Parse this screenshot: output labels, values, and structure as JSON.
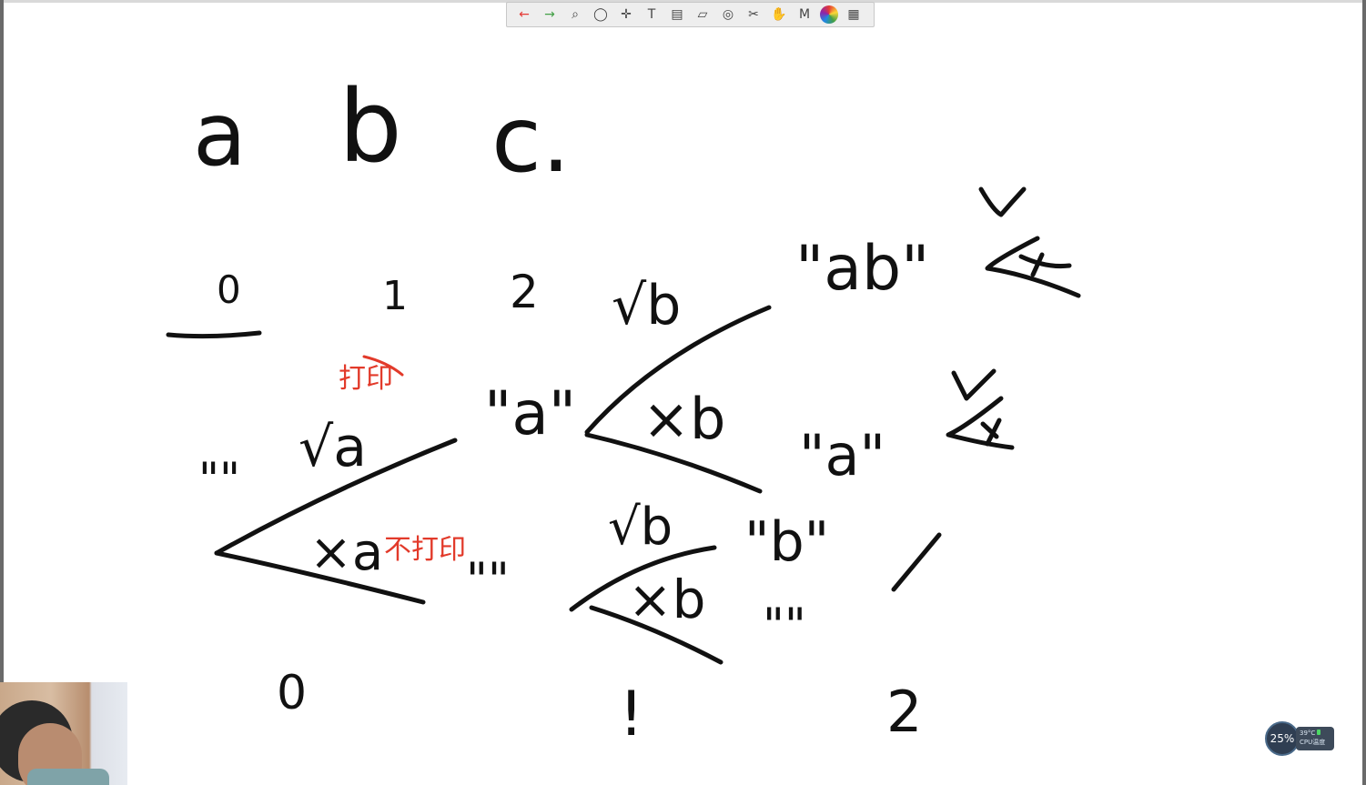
{
  "toolbar": {
    "tools": [
      {
        "name": "undo-icon",
        "glyph": "←",
        "color": "#e53935"
      },
      {
        "name": "redo-icon",
        "glyph": "→",
        "color": "#43a047"
      },
      {
        "name": "zoom-icon",
        "glyph": "⌕"
      },
      {
        "name": "lasso-icon",
        "glyph": "◯"
      },
      {
        "name": "move-icon",
        "glyph": "✛"
      },
      {
        "name": "text-tool-icon",
        "glyph": "T"
      },
      {
        "name": "clipboard-icon",
        "glyph": "▤"
      },
      {
        "name": "eraser-icon",
        "glyph": "▱"
      },
      {
        "name": "target-icon",
        "glyph": "◎"
      },
      {
        "name": "scissors-icon",
        "glyph": "✂"
      },
      {
        "name": "hand-icon",
        "glyph": "✋"
      },
      {
        "name": "marker-icon",
        "glyph": "M"
      },
      {
        "name": "color-wheel-icon",
        "glyph": "●"
      },
      {
        "name": "grid-icon",
        "glyph": "▦"
      }
    ]
  },
  "board": {
    "letters": [
      "a",
      "b",
      "c."
    ],
    "indices": [
      "0",
      "1",
      "2"
    ],
    "tree": {
      "root_empty": "\"\"",
      "take_a": "√a",
      "skip_a": "×a",
      "node_a": "\"a\"",
      "node_empty2": "\"\"",
      "take_b_upper": "√b",
      "skip_b_upper": "×b",
      "take_b_lower": "√b",
      "skip_b_lower": "×b",
      "leaf_ab": "\"ab\"",
      "leaf_a": "\"a\"",
      "leaf_b": "\"b\"",
      "leaf_empty": "\"\""
    },
    "levels": [
      "0",
      "!",
      "2"
    ],
    "annotations": {
      "print": "打印",
      "no_print": "不打印"
    }
  },
  "widget": {
    "gauge_value": "25%",
    "line1": "39°C",
    "line2": "CPU温度"
  },
  "colors": {
    "ink": "#111111",
    "annotation": "#e23a2a",
    "toolbar_bg": "#eeeeee"
  }
}
